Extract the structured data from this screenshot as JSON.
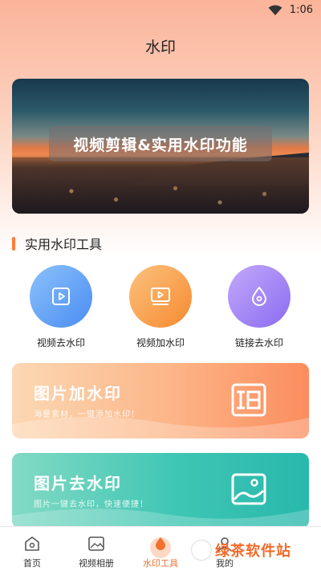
{
  "status_bar": {
    "time": "1:06"
  },
  "header": {
    "title": "水印"
  },
  "banner": {
    "caption": "视频剪辑&实用水印功能"
  },
  "tools_section": {
    "title": "实用水印工具",
    "tools": [
      {
        "label": "视频去水印",
        "icon": "video-play-icon",
        "color": "#5b9cf6"
      },
      {
        "label": "视频加水印",
        "icon": "video-screen-icon",
        "color": "#f8a046"
      },
      {
        "label": "链接去水印",
        "icon": "water-drop-icon",
        "color": "#9a7cf0"
      }
    ]
  },
  "cards": [
    {
      "title": "图片加水印",
      "subtitle": "海量素材，一键添加水印！",
      "icon": "stamp-icon"
    },
    {
      "title": "图片去水印",
      "subtitle": "图片一键去水印，快速便捷！",
      "icon": "image-icon"
    }
  ],
  "tabbar": {
    "tabs": [
      {
        "label": "首页",
        "icon": "home-icon"
      },
      {
        "label": "视频相册",
        "icon": "photo-album-icon"
      },
      {
        "label": "水印工具",
        "icon": "watermark-tool-icon",
        "active": true
      },
      {
        "label": "我的",
        "icon": "profile-icon"
      }
    ]
  },
  "overlay_watermark": {
    "text": "绿茶软件站"
  },
  "colors": {
    "accent": "#f2712e",
    "card_orange": "#fb8d5e",
    "card_teal": "#28b8ac"
  }
}
